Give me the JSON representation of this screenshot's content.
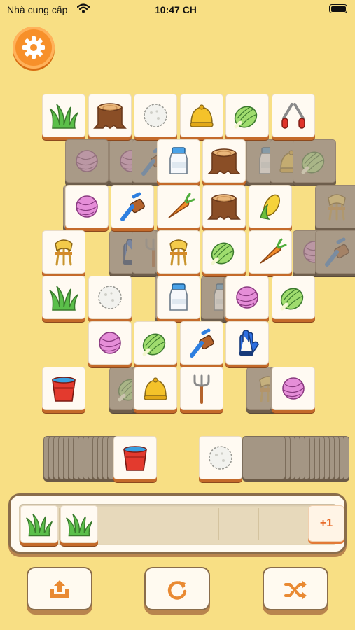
{
  "status_bar": {
    "carrier": "Nhà cung cấp",
    "time": "10:47 CH"
  },
  "colors": {
    "background": "#f8df84",
    "accent": "#f7902a",
    "tile_edge": "#c46a2a"
  },
  "settings": {
    "icon": "gear-icon"
  },
  "board": {
    "tiles": [
      {
        "icon": "grass",
        "row": 0,
        "col": 0,
        "layer": "top"
      },
      {
        "icon": "stump",
        "row": 0,
        "col": 1,
        "layer": "top"
      },
      {
        "icon": "cotton",
        "row": 0,
        "col": 2,
        "layer": "top"
      },
      {
        "icon": "bell",
        "row": 0,
        "col": 3,
        "layer": "top"
      },
      {
        "icon": "cabbage",
        "row": 0,
        "col": 4,
        "layer": "top"
      },
      {
        "icon": "shears",
        "row": 0,
        "col": 5,
        "layer": "top"
      },
      {
        "icon": "yarn",
        "row": 1,
        "col": 0.5,
        "layer": "covered"
      },
      {
        "icon": "milk",
        "row": 1,
        "col": 2.5,
        "layer": "top"
      },
      {
        "icon": "stump",
        "row": 1,
        "col": 3.5,
        "layer": "top"
      },
      {
        "icon": "yarn",
        "row": 2,
        "col": 0.5,
        "layer": "top"
      },
      {
        "icon": "brush",
        "row": 2,
        "col": 1.5,
        "layer": "top"
      },
      {
        "icon": "carrot",
        "row": 2,
        "col": 2.5,
        "layer": "top"
      },
      {
        "icon": "stump",
        "row": 2,
        "col": 3.5,
        "layer": "top"
      },
      {
        "icon": "corn",
        "row": 2,
        "col": 4.5,
        "layer": "top"
      },
      {
        "icon": "wheat",
        "row": 3,
        "col": 0,
        "layer": "top"
      },
      {
        "icon": "wheat",
        "row": 3,
        "col": 2.5,
        "layer": "top"
      },
      {
        "icon": "cabbage",
        "row": 3,
        "col": 3.5,
        "layer": "top"
      },
      {
        "icon": "carrot",
        "row": 3,
        "col": 4.5,
        "layer": "top"
      },
      {
        "icon": "grass",
        "row": 4,
        "col": 0,
        "layer": "top"
      },
      {
        "icon": "cotton",
        "row": 4,
        "col": 1,
        "layer": "top"
      },
      {
        "icon": "milk",
        "row": 4,
        "col": 2.5,
        "layer": "top"
      },
      {
        "icon": "yarn",
        "row": 4,
        "col": 4,
        "layer": "top"
      },
      {
        "icon": "cabbage",
        "row": 4,
        "col": 5,
        "layer": "top"
      },
      {
        "icon": "yarn",
        "row": 5,
        "col": 1,
        "layer": "top"
      },
      {
        "icon": "cabbage",
        "row": 5,
        "col": 2,
        "layer": "top"
      },
      {
        "icon": "brush",
        "row": 5,
        "col": 3,
        "layer": "top"
      },
      {
        "icon": "glove",
        "row": 5,
        "col": 4,
        "layer": "top"
      },
      {
        "icon": "bucket",
        "row": 6,
        "col": 0,
        "layer": "top"
      },
      {
        "icon": "bell",
        "row": 6,
        "col": 2,
        "layer": "top"
      },
      {
        "icon": "pitchfork",
        "row": 6,
        "col": 3,
        "layer": "top"
      },
      {
        "icon": "yarn",
        "row": 6,
        "col": 5,
        "layer": "top"
      }
    ]
  },
  "stacks": {
    "left": {
      "top_icon": "bucket",
      "count": 14
    },
    "right": {
      "top_icon": "cotton",
      "count": 14
    }
  },
  "tray": {
    "slots": [
      "grass",
      "grass"
    ],
    "capacity": 7,
    "plus_label": "+1"
  },
  "toolbar": [
    {
      "name": "undo-out-button",
      "icon": "tray-arrow-up-icon"
    },
    {
      "name": "refresh-button",
      "icon": "refresh-icon"
    },
    {
      "name": "shuffle-button",
      "icon": "shuffle-icon"
    }
  ]
}
